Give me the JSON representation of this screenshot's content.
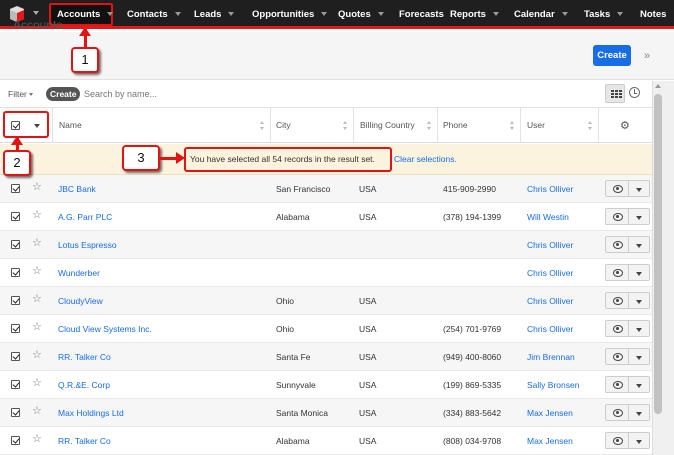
{
  "nav": {
    "items": [
      {
        "label": "Accounts",
        "active": true
      },
      {
        "label": "Contacts"
      },
      {
        "label": "Leads"
      },
      {
        "label": "Opportunities"
      },
      {
        "label": "Quotes"
      },
      {
        "label": "Forecasts"
      },
      {
        "label": "Reports"
      },
      {
        "label": "Calendar"
      },
      {
        "label": "Tasks"
      },
      {
        "label": "Notes"
      }
    ]
  },
  "header": {
    "title": "Accounts",
    "create_label": "Create"
  },
  "filter": {
    "filter_label": "Filter",
    "create_label": "Create",
    "search_placeholder": "Search by name..."
  },
  "table": {
    "columns": [
      "Name",
      "City",
      "Billing Country",
      "Phone",
      "User"
    ],
    "selection_message": "You have selected all 54 records in the result set.",
    "clear_label": "Clear selections.",
    "rows": [
      {
        "name": "JBC Bank",
        "city": "San Francisco",
        "country": "USA",
        "phone": "415-909-2990",
        "user": "Chris Olliver"
      },
      {
        "name": "A.G. Parr PLC",
        "city": "Alabama",
        "country": "USA",
        "phone": "(378) 194-1399",
        "user": "Will Westin"
      },
      {
        "name": "Lotus Espresso",
        "city": "",
        "country": "",
        "phone": "",
        "user": "Chris Olliver"
      },
      {
        "name": "Wunderber",
        "city": "",
        "country": "",
        "phone": "",
        "user": "Chris Olliver"
      },
      {
        "name": "CloudyView",
        "city": "Ohio",
        "country": "USA",
        "phone": "",
        "user": "Chris Olliver"
      },
      {
        "name": "Cloud View Systems Inc.",
        "city": "Ohio",
        "country": "USA",
        "phone": "(254) 701-9769",
        "user": "Chris Olliver"
      },
      {
        "name": "RR. Talker Co",
        "city": "Santa Fe",
        "country": "USA",
        "phone": "(949) 400-8060",
        "user": "Jim Brennan"
      },
      {
        "name": "Q.R.&E. Corp",
        "city": "Sunnyvale",
        "country": "USA",
        "phone": "(199) 869-5335",
        "user": "Sally Bronsen"
      },
      {
        "name": "Max Holdings Ltd",
        "city": "Santa Monica",
        "country": "USA",
        "phone": "(334) 883-5642",
        "user": "Max Jensen"
      },
      {
        "name": "RR. Talker Co",
        "city": "Alabama",
        "country": "USA",
        "phone": "(808) 034-9708",
        "user": "Max Jensen"
      }
    ]
  },
  "annotations": {
    "step1": "1",
    "step2": "2",
    "step3": "3"
  },
  "colors": {
    "accent": "#176de5",
    "nav_bg": "#1f1f1f",
    "highlight_red": "#e01414",
    "banner_bg": "#fbf3dd"
  }
}
